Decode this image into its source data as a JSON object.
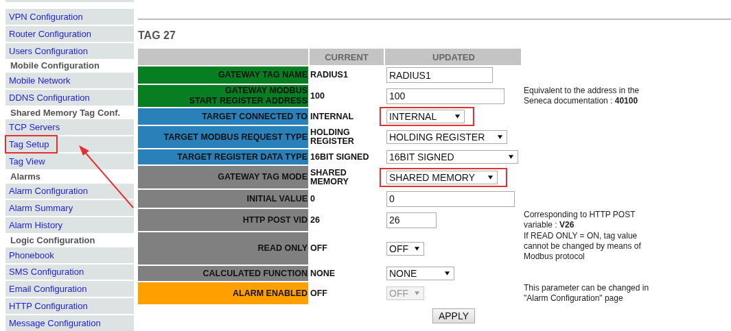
{
  "sidebar": {
    "items": [
      {
        "kind": "link",
        "label": "VPN Configuration",
        "highlighted": false
      },
      {
        "kind": "link",
        "label": "Router Configuration",
        "highlighted": false
      },
      {
        "kind": "link",
        "label": "Users Configuration",
        "highlighted": false
      },
      {
        "kind": "heading",
        "label": "Mobile Configuration",
        "highlighted": false
      },
      {
        "kind": "link",
        "label": "Mobile Network",
        "highlighted": false
      },
      {
        "kind": "link",
        "label": "DDNS Configuration",
        "highlighted": false
      },
      {
        "kind": "heading",
        "label": "Shared Memory Tag Conf.",
        "highlighted": false
      },
      {
        "kind": "link",
        "label": "TCP Servers",
        "highlighted": false
      },
      {
        "kind": "link",
        "label": "Tag Setup",
        "highlighted": true
      },
      {
        "kind": "link",
        "label": "Tag View",
        "highlighted": false
      },
      {
        "kind": "heading",
        "label": "Alarms",
        "highlighted": false
      },
      {
        "kind": "link",
        "label": "Alarm Configuration",
        "highlighted": false
      },
      {
        "kind": "link",
        "label": "Alarm Summary",
        "highlighted": false
      },
      {
        "kind": "link",
        "label": "Alarm History",
        "highlighted": false
      },
      {
        "kind": "heading",
        "label": "Logic Configuration",
        "highlighted": false
      },
      {
        "kind": "link",
        "label": "Phonebook",
        "highlighted": false
      },
      {
        "kind": "link",
        "label": "SMS Configuration",
        "highlighted": false
      },
      {
        "kind": "link",
        "label": "Email Configuration",
        "highlighted": false
      },
      {
        "kind": "link",
        "label": "HTTP Configuration",
        "highlighted": false
      },
      {
        "kind": "link",
        "label": "Message Configuration",
        "highlighted": false
      }
    ]
  },
  "title": "TAG 27",
  "table": {
    "columns": [
      "CURRENT",
      "UPDATED"
    ],
    "rows": [
      {
        "label": "GATEWAY TAG NAME",
        "color": "#077e22",
        "current": "RADIUS1",
        "control": {
          "kind": "input",
          "value": "RADIUS1",
          "highlighted": false,
          "disabled": false
        }
      },
      {
        "label": "GATEWAY MODBUS\nSTART REGISTER ADDRESS",
        "color": "#077e22",
        "current": "100",
        "control": {
          "kind": "input",
          "value": "100",
          "highlighted": false,
          "disabled": false
        },
        "note": "Equivalent to the address in the Seneca documentation : **40100**"
      },
      {
        "label": "TARGET CONNECTED TO",
        "color": "#2a80b9",
        "current": "INTERNAL",
        "control": {
          "kind": "select",
          "value": "INTERNAL",
          "highlighted": true,
          "disabled": false
        }
      },
      {
        "label": "TARGET MODBUS REQUEST TYPE",
        "color": "#2a80b9",
        "current": "HOLDING\nREGISTER",
        "control": {
          "kind": "select",
          "value": "HOLDING REGISTER",
          "highlighted": false,
          "disabled": false
        }
      },
      {
        "label": "TARGET REGISTER DATA TYPE",
        "color": "#2a80b9",
        "current": "16BIT SIGNED",
        "control": {
          "kind": "select",
          "value": "16BIT SIGNED",
          "highlighted": false,
          "disabled": false
        }
      },
      {
        "label": "GATEWAY TAG MODE",
        "color": "#808080",
        "current": "SHARED\nMEMORY",
        "control": {
          "kind": "select",
          "value": "SHARED MEMORY",
          "highlighted": true,
          "disabled": false
        }
      },
      {
        "label": "INITIAL VALUE",
        "color": "#808080",
        "current": "0",
        "control": {
          "kind": "input",
          "value": "0",
          "highlighted": false,
          "disabled": false
        }
      },
      {
        "label": "HTTP POST VID",
        "color": "#808080",
        "current": "26",
        "control": {
          "kind": "input",
          "value": "26",
          "highlighted": false,
          "disabled": false
        },
        "note": "Corresponding to HTTP POST variable : **V26**"
      },
      {
        "label": "READ ONLY",
        "color": "#808080",
        "current": "OFF",
        "control": {
          "kind": "select",
          "value": "OFF",
          "highlighted": false,
          "disabled": false
        },
        "note": "If READ ONLY = ON, tag value cannot be changed by means of Modbus protocol"
      },
      {
        "label": "CALCULATED FUNCTION",
        "color": "#808080",
        "current": "NONE",
        "control": {
          "kind": "select",
          "value": "NONE",
          "highlighted": false,
          "disabled": false
        }
      },
      {
        "label": "ALARM ENABLED",
        "color": "#ffa000",
        "current": "OFF",
        "control": {
          "kind": "select",
          "value": "OFF",
          "highlighted": false,
          "disabled": true
        },
        "note": "This parameter can be changed in \"Alarm Configuration\" page"
      }
    ]
  },
  "apply_button": "APPLY"
}
